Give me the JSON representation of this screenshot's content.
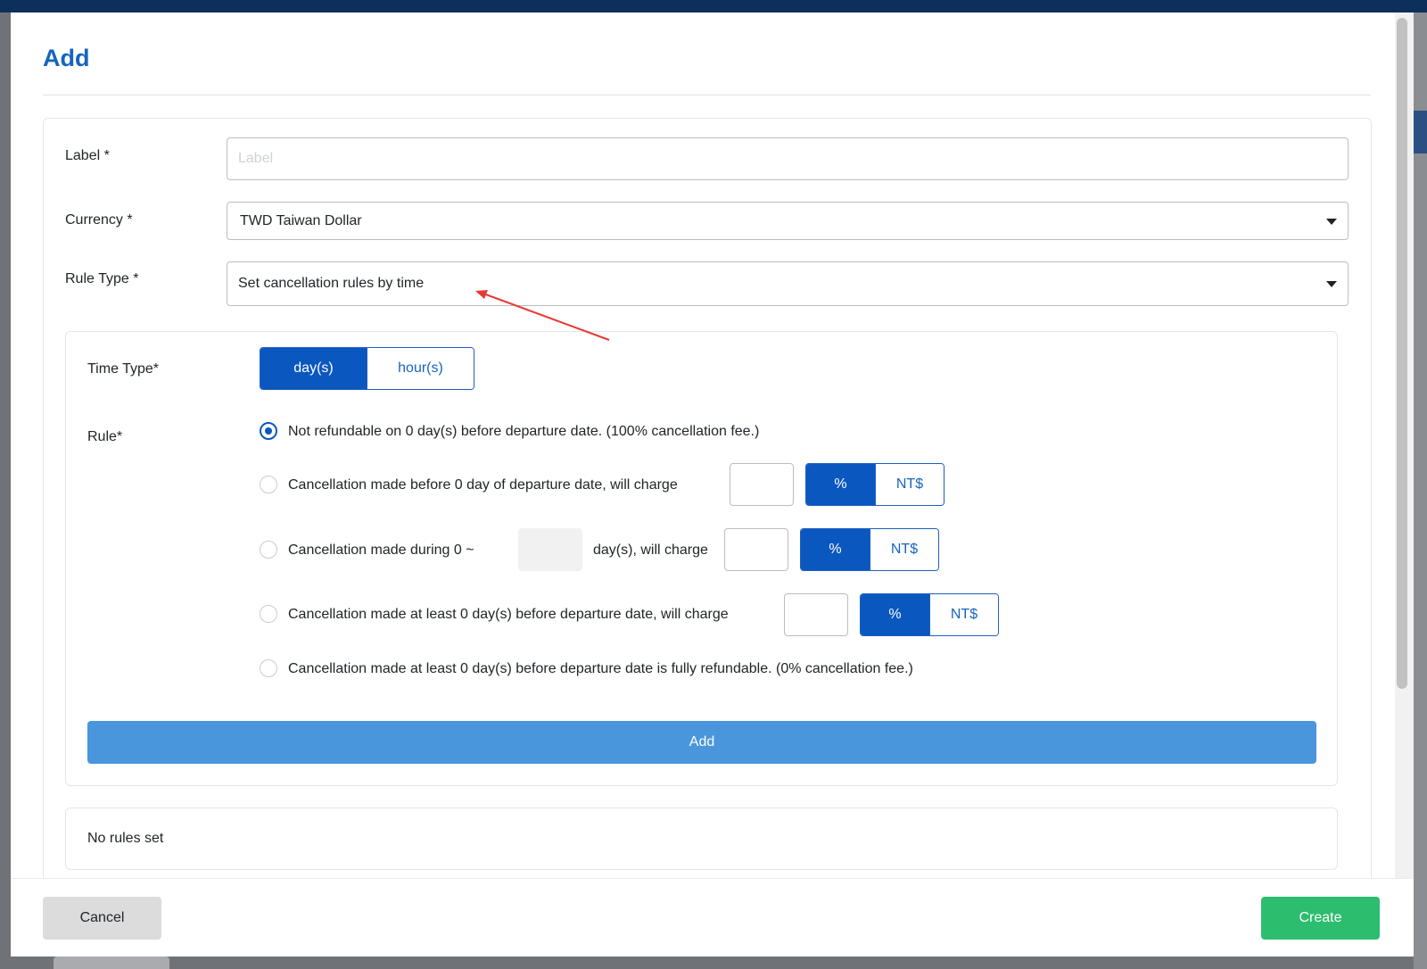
{
  "modal": {
    "title": "Add",
    "fields": {
      "label": {
        "label": "Label *",
        "value": "",
        "placeholder": "Label"
      },
      "currency": {
        "label": "Currency *",
        "value": "TWD Taiwan Dollar"
      },
      "rule_type": {
        "label": "Rule Type *",
        "value": "Set cancellation rules by time"
      }
    },
    "time_type": {
      "label": "Time Type*",
      "options": [
        "day(s)",
        "hour(s)"
      ],
      "selected": "day(s)"
    },
    "rule": {
      "label": "Rule*",
      "options": [
        {
          "text": "Not refundable on 0 day(s) before departure date. (100% cancellation fee.)",
          "checked": true
        },
        {
          "text": "Cancellation made before 0 day of departure date, will charge",
          "checked": false,
          "unit_options": [
            "%",
            "NT$"
          ],
          "unit_selected": "%"
        },
        {
          "text_before": "Cancellation made during 0 ~",
          "text_after": "day(s), will charge",
          "checked": false,
          "unit_options": [
            "%",
            "NT$"
          ],
          "unit_selected": "%"
        },
        {
          "text": "Cancellation made at least 0 day(s) before departure date, will charge",
          "checked": false,
          "unit_options": [
            "%",
            "NT$"
          ],
          "unit_selected": "%"
        },
        {
          "text": "Cancellation made at least 0 day(s) before departure date is fully refundable. (0% cancellation fee.)",
          "checked": false
        }
      ]
    },
    "add_button": "Add",
    "empty_rules_text": "No rules set",
    "footer": {
      "cancel": "Cancel",
      "create": "Create"
    }
  },
  "colors": {
    "primary": "#0b57c0",
    "title": "#1565c0",
    "add_button": "#4a96dc",
    "create_button": "#2dbd6e",
    "cancel_button": "#dcdcdc",
    "annotation_arrow": "#e53935"
  }
}
